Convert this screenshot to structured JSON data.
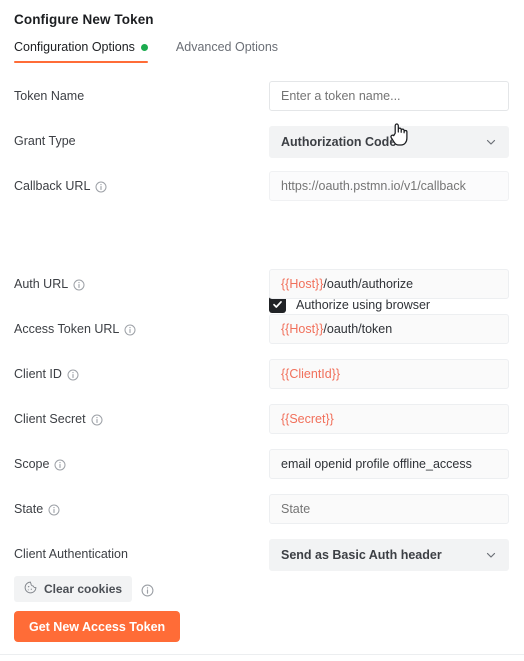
{
  "panel": {
    "title": "Configure New Token"
  },
  "tabs": [
    {
      "label": "Configuration Options",
      "active": true,
      "has_dot": true
    },
    {
      "label": "Advanced Options",
      "active": false,
      "has_dot": false
    }
  ],
  "fields": {
    "token_name": {
      "label": "Token Name",
      "has_info": false,
      "type": "input",
      "value": "",
      "placeholder": "Enter a token name..."
    },
    "grant_type": {
      "label": "Grant Type",
      "has_info": false,
      "type": "select",
      "value": "Authorization Code"
    },
    "callback_url": {
      "label": "Callback URL",
      "has_info": true,
      "type": "input",
      "disabled": true,
      "value": "",
      "placeholder": "https://oauth.pstmn.io/v1/callback"
    },
    "authorize_browser": {
      "label": "Authorize using browser",
      "checked": true
    },
    "auth_url": {
      "label": "Auth URL",
      "has_info": true,
      "type": "input",
      "value_variable": "{{Host}}",
      "value_rest": "/oauth/authorize"
    },
    "access_token_url": {
      "label": "Access Token URL",
      "has_info": true,
      "type": "input",
      "value_variable": "{{Host}}",
      "value_rest": "/oauth/token"
    },
    "client_id": {
      "label": "Client ID",
      "has_info": true,
      "type": "input",
      "value_variable": "{{ClientId}}",
      "value_rest": ""
    },
    "client_secret": {
      "label": "Client Secret",
      "has_info": true,
      "type": "input",
      "value_variable": "{{Secret}}",
      "value_rest": ""
    },
    "scope": {
      "label": "Scope",
      "has_info": true,
      "type": "input",
      "value": "email openid profile offline_access"
    },
    "state": {
      "label": "State",
      "has_info": true,
      "type": "input",
      "value": "",
      "placeholder": "State"
    },
    "client_authentication": {
      "label": "Client Authentication",
      "has_info": false,
      "type": "select",
      "value": "Send as Basic Auth header"
    }
  },
  "footer": {
    "clear_cookies_label": "Clear cookies",
    "get_token_label": "Get New Access Token"
  },
  "colors": {
    "accent_orange": "#ff6c37",
    "status_green": "#1bab4e",
    "variable_red": "#f1705b",
    "checkbox_dark": "#212326"
  },
  "icons": {
    "info": "info-icon",
    "chevron": "chevron-down-icon",
    "cookie": "cookie-icon",
    "check": "check-icon",
    "cursor": "pointer-hand-cursor"
  }
}
